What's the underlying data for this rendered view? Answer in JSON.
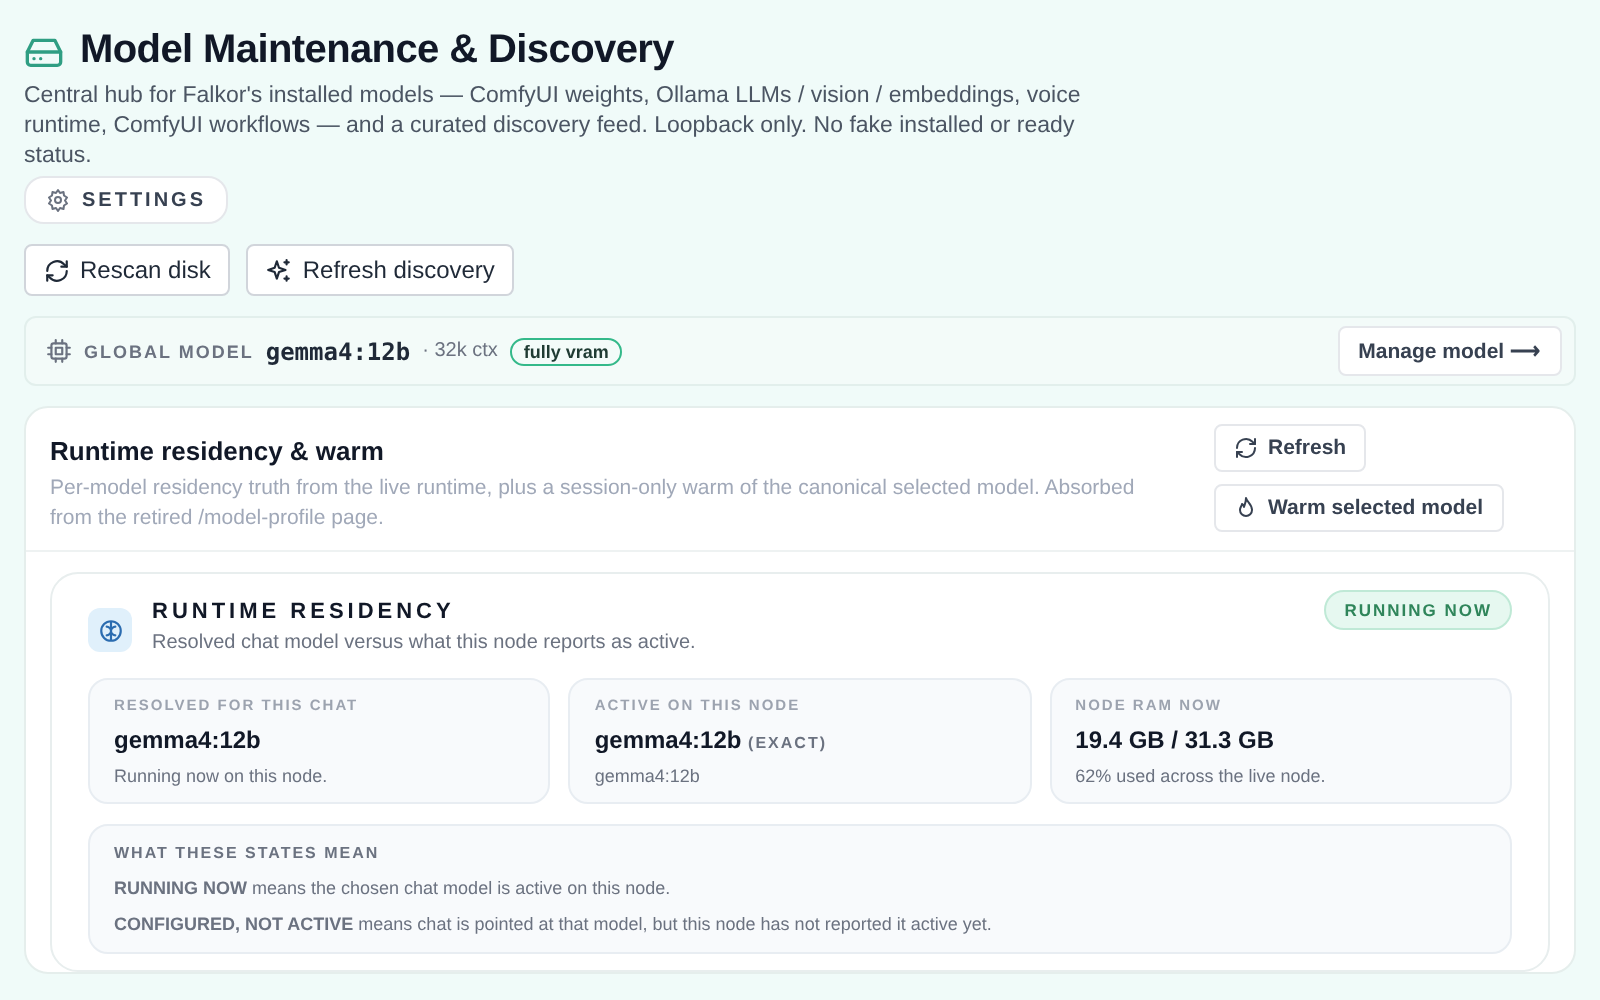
{
  "header": {
    "title": "Model Maintenance & Discovery",
    "description": "Central hub for Falkor's installed models — ComfyUI weights, Ollama LLMs / vision / embeddings, voice runtime, ComfyUI workflows — and a curated discovery feed. Loopback only. No fake installed or ready status.",
    "settings_label": "SETTINGS"
  },
  "actions": [
    {
      "kind": "rescan",
      "label": "Rescan disk"
    },
    {
      "kind": "discover",
      "label": "Refresh discovery"
    }
  ],
  "global_model": {
    "label": "GLOBAL MODEL",
    "model": "gemma4:12b",
    "context": "· 32k ctx",
    "badge": "fully vram",
    "button": "Manage model ⟶"
  },
  "runtime_card": {
    "title": "Runtime residency & warm",
    "description": "Per-model residency truth from the live runtime, plus a session-only warm of the canonical selected model. Absorbed from the retired /model-profile page.",
    "buttons": [
      {
        "kind": "refresh",
        "label": "Refresh"
      },
      {
        "kind": "warm",
        "label": "Warm selected model"
      }
    ],
    "residency": {
      "title": "RUNTIME RESIDENCY",
      "subtitle": "Resolved chat model versus what this node reports as active.",
      "status": "RUNNING NOW",
      "stats": [
        {
          "label": "RESOLVED FOR THIS CHAT",
          "value": "gemma4:12b",
          "note": "Running now on this node."
        },
        {
          "label": "ACTIVE ON THIS NODE",
          "value": "gemma4:12b",
          "tag": "(EXACT)",
          "note": "gemma4:12b"
        },
        {
          "label": "NODE RAM NOW",
          "value": "19.4 GB / 31.3 GB",
          "note": "62% used across the live node."
        }
      ],
      "legend": {
        "title": "WHAT THESE STATES MEAN",
        "lines": [
          "**RUNNING NOW** means the chosen chat model is active on this node.",
          "**CONFIGURED, NOT ACTIVE** means chat is pointed at that model, but this node has not reported it active yet."
        ]
      }
    }
  }
}
